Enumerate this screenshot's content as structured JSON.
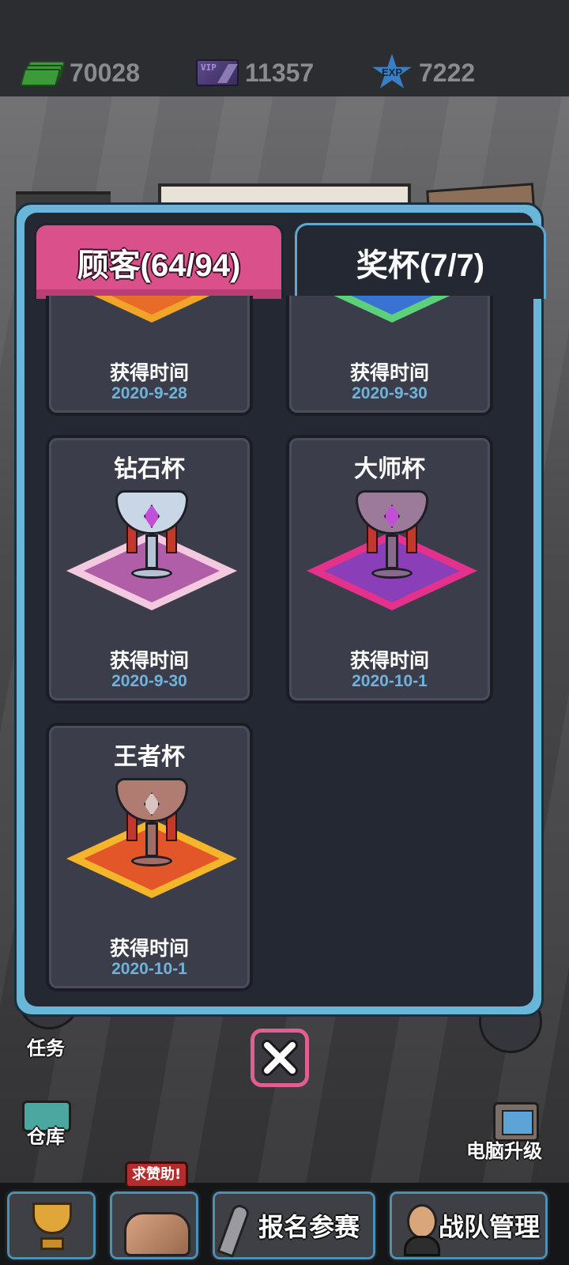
{
  "currencies": {
    "cash": {
      "value": "70028",
      "icon": "cash-icon"
    },
    "vip": {
      "value": "11357",
      "icon": "vip-ticket-icon",
      "badge_text": "VIP"
    },
    "exp": {
      "value": "7222",
      "icon": "exp-star-icon",
      "badge_text": "EXP"
    }
  },
  "modal": {
    "tabs": [
      {
        "label": "顾客(64/94)",
        "active": false,
        "color": "#d9508a"
      },
      {
        "label": "奖杯(7/7)",
        "active": true
      }
    ],
    "acquired_label": "获得时间",
    "trophies": [
      {
        "name": "",
        "date": "2020-9-28",
        "partial": true
      },
      {
        "name": "",
        "date": "2020-9-30",
        "partial": true
      },
      {
        "name": "钻石杯",
        "date": "2020-9-30"
      },
      {
        "name": "大师杯",
        "date": "2020-10-1"
      },
      {
        "name": "王者杯",
        "date": "2020-10-1"
      }
    ],
    "close_icon": "close-icon",
    "accent_color": "#6ab6d9",
    "date_color": "#6fb3dc"
  },
  "side_buttons": {
    "tasks": "任务",
    "warehouse": "仓库",
    "pc_upgrade": "电脑升级"
  },
  "bottom_nav": {
    "help_badge": "求赞助!",
    "register": "报名参赛",
    "team": "战队管理"
  }
}
